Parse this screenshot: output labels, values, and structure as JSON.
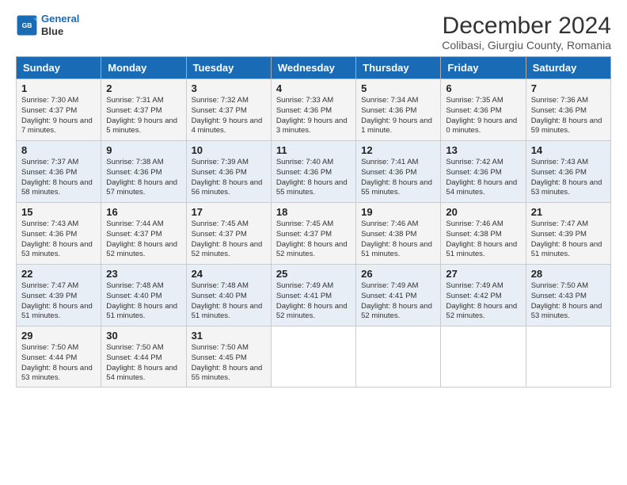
{
  "header": {
    "logo_line1": "General",
    "logo_line2": "Blue",
    "title": "December 2024",
    "subtitle": "Colibasi, Giurgiu County, Romania"
  },
  "weekdays": [
    "Sunday",
    "Monday",
    "Tuesday",
    "Wednesday",
    "Thursday",
    "Friday",
    "Saturday"
  ],
  "weeks": [
    [
      {
        "day": "1",
        "sunrise": "Sunrise: 7:30 AM",
        "sunset": "Sunset: 4:37 PM",
        "daylight": "Daylight: 9 hours and 7 minutes."
      },
      {
        "day": "2",
        "sunrise": "Sunrise: 7:31 AM",
        "sunset": "Sunset: 4:37 PM",
        "daylight": "Daylight: 9 hours and 5 minutes."
      },
      {
        "day": "3",
        "sunrise": "Sunrise: 7:32 AM",
        "sunset": "Sunset: 4:37 PM",
        "daylight": "Daylight: 9 hours and 4 minutes."
      },
      {
        "day": "4",
        "sunrise": "Sunrise: 7:33 AM",
        "sunset": "Sunset: 4:36 PM",
        "daylight": "Daylight: 9 hours and 3 minutes."
      },
      {
        "day": "5",
        "sunrise": "Sunrise: 7:34 AM",
        "sunset": "Sunset: 4:36 PM",
        "daylight": "Daylight: 9 hours and 1 minute."
      },
      {
        "day": "6",
        "sunrise": "Sunrise: 7:35 AM",
        "sunset": "Sunset: 4:36 PM",
        "daylight": "Daylight: 9 hours and 0 minutes."
      },
      {
        "day": "7",
        "sunrise": "Sunrise: 7:36 AM",
        "sunset": "Sunset: 4:36 PM",
        "daylight": "Daylight: 8 hours and 59 minutes."
      }
    ],
    [
      {
        "day": "8",
        "sunrise": "Sunrise: 7:37 AM",
        "sunset": "Sunset: 4:36 PM",
        "daylight": "Daylight: 8 hours and 58 minutes."
      },
      {
        "day": "9",
        "sunrise": "Sunrise: 7:38 AM",
        "sunset": "Sunset: 4:36 PM",
        "daylight": "Daylight: 8 hours and 57 minutes."
      },
      {
        "day": "10",
        "sunrise": "Sunrise: 7:39 AM",
        "sunset": "Sunset: 4:36 PM",
        "daylight": "Daylight: 8 hours and 56 minutes."
      },
      {
        "day": "11",
        "sunrise": "Sunrise: 7:40 AM",
        "sunset": "Sunset: 4:36 PM",
        "daylight": "Daylight: 8 hours and 55 minutes."
      },
      {
        "day": "12",
        "sunrise": "Sunrise: 7:41 AM",
        "sunset": "Sunset: 4:36 PM",
        "daylight": "Daylight: 8 hours and 55 minutes."
      },
      {
        "day": "13",
        "sunrise": "Sunrise: 7:42 AM",
        "sunset": "Sunset: 4:36 PM",
        "daylight": "Daylight: 8 hours and 54 minutes."
      },
      {
        "day": "14",
        "sunrise": "Sunrise: 7:43 AM",
        "sunset": "Sunset: 4:36 PM",
        "daylight": "Daylight: 8 hours and 53 minutes."
      }
    ],
    [
      {
        "day": "15",
        "sunrise": "Sunrise: 7:43 AM",
        "sunset": "Sunset: 4:36 PM",
        "daylight": "Daylight: 8 hours and 53 minutes."
      },
      {
        "day": "16",
        "sunrise": "Sunrise: 7:44 AM",
        "sunset": "Sunset: 4:37 PM",
        "daylight": "Daylight: 8 hours and 52 minutes."
      },
      {
        "day": "17",
        "sunrise": "Sunrise: 7:45 AM",
        "sunset": "Sunset: 4:37 PM",
        "daylight": "Daylight: 8 hours and 52 minutes."
      },
      {
        "day": "18",
        "sunrise": "Sunrise: 7:45 AM",
        "sunset": "Sunset: 4:37 PM",
        "daylight": "Daylight: 8 hours and 52 minutes."
      },
      {
        "day": "19",
        "sunrise": "Sunrise: 7:46 AM",
        "sunset": "Sunset: 4:38 PM",
        "daylight": "Daylight: 8 hours and 51 minutes."
      },
      {
        "day": "20",
        "sunrise": "Sunrise: 7:46 AM",
        "sunset": "Sunset: 4:38 PM",
        "daylight": "Daylight: 8 hours and 51 minutes."
      },
      {
        "day": "21",
        "sunrise": "Sunrise: 7:47 AM",
        "sunset": "Sunset: 4:39 PM",
        "daylight": "Daylight: 8 hours and 51 minutes."
      }
    ],
    [
      {
        "day": "22",
        "sunrise": "Sunrise: 7:47 AM",
        "sunset": "Sunset: 4:39 PM",
        "daylight": "Daylight: 8 hours and 51 minutes."
      },
      {
        "day": "23",
        "sunrise": "Sunrise: 7:48 AM",
        "sunset": "Sunset: 4:40 PM",
        "daylight": "Daylight: 8 hours and 51 minutes."
      },
      {
        "day": "24",
        "sunrise": "Sunrise: 7:48 AM",
        "sunset": "Sunset: 4:40 PM",
        "daylight": "Daylight: 8 hours and 51 minutes."
      },
      {
        "day": "25",
        "sunrise": "Sunrise: 7:49 AM",
        "sunset": "Sunset: 4:41 PM",
        "daylight": "Daylight: 8 hours and 52 minutes."
      },
      {
        "day": "26",
        "sunrise": "Sunrise: 7:49 AM",
        "sunset": "Sunset: 4:41 PM",
        "daylight": "Daylight: 8 hours and 52 minutes."
      },
      {
        "day": "27",
        "sunrise": "Sunrise: 7:49 AM",
        "sunset": "Sunset: 4:42 PM",
        "daylight": "Daylight: 8 hours and 52 minutes."
      },
      {
        "day": "28",
        "sunrise": "Sunrise: 7:50 AM",
        "sunset": "Sunset: 4:43 PM",
        "daylight": "Daylight: 8 hours and 53 minutes."
      }
    ],
    [
      {
        "day": "29",
        "sunrise": "Sunrise: 7:50 AM",
        "sunset": "Sunset: 4:44 PM",
        "daylight": "Daylight: 8 hours and 53 minutes."
      },
      {
        "day": "30",
        "sunrise": "Sunrise: 7:50 AM",
        "sunset": "Sunset: 4:44 PM",
        "daylight": "Daylight: 8 hours and 54 minutes."
      },
      {
        "day": "31",
        "sunrise": "Sunrise: 7:50 AM",
        "sunset": "Sunset: 4:45 PM",
        "daylight": "Daylight: 8 hours and 55 minutes."
      },
      null,
      null,
      null,
      null
    ]
  ]
}
